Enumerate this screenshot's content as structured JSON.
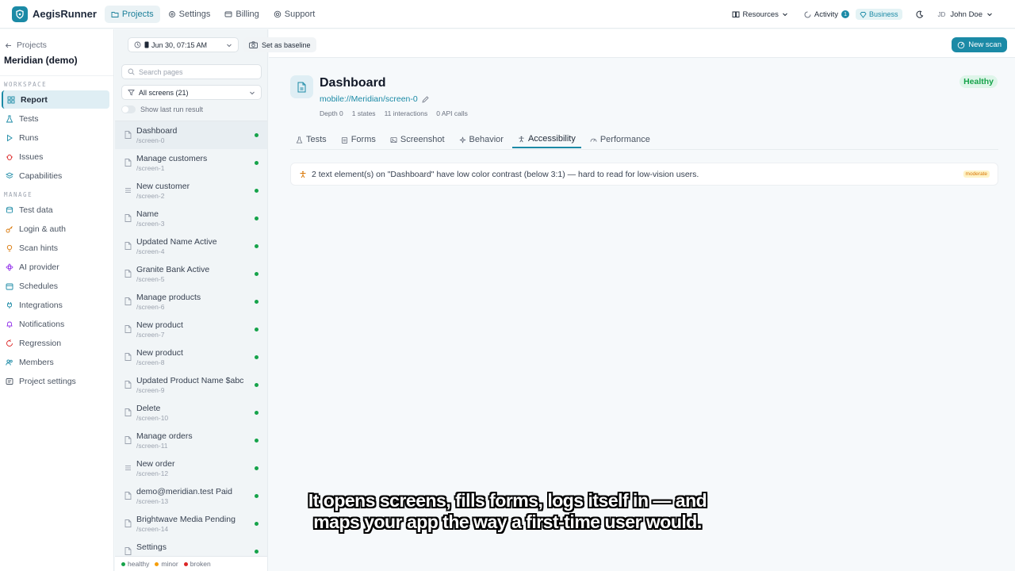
{
  "brand": {
    "name": "AegisRunner"
  },
  "topnav": {
    "items": [
      {
        "label": "Projects",
        "icon": "folder-icon",
        "active": true
      },
      {
        "label": "Settings",
        "icon": "gear-icon",
        "active": false
      },
      {
        "label": "Billing",
        "icon": "card-icon",
        "active": false
      },
      {
        "label": "Support",
        "icon": "support-icon",
        "active": false
      }
    ],
    "resources": "Resources",
    "activity": "Activity",
    "activity_count": "1",
    "plan": "Business",
    "user_initials": "JD",
    "user_name": "John Doe"
  },
  "sidebar": {
    "back_label": "Projects",
    "project_name": "Meridian (demo)",
    "workspace_label": "WORKSPACE",
    "workspace_items": [
      "Report",
      "Tests",
      "Runs",
      "Issues",
      "Capabilities"
    ],
    "manage_label": "MANAGE",
    "manage_items": [
      "Test data",
      "Login & auth",
      "Scan hints",
      "AI provider",
      "Schedules",
      "Integrations",
      "Notifications",
      "Regression",
      "Members",
      "Project settings"
    ]
  },
  "pages_panel": {
    "search_placeholder": "Search pages",
    "filter_value": "All screens (21)",
    "toggle_label": "Show last run result",
    "items": [
      {
        "title": "Dashboard",
        "path": "/screen-0"
      },
      {
        "title": "Manage customers",
        "path": "/screen-1"
      },
      {
        "title": "New customer",
        "path": "/screen-2"
      },
      {
        "title": "Name",
        "path": "/screen-3"
      },
      {
        "title": "Updated Name Active",
        "path": "/screen-4"
      },
      {
        "title": "Granite Bank Active",
        "path": "/screen-5"
      },
      {
        "title": "Manage products",
        "path": "/screen-6"
      },
      {
        "title": "New product",
        "path": "/screen-7"
      },
      {
        "title": "New product",
        "path": "/screen-8"
      },
      {
        "title": "Updated Product Name $abc",
        "path": "/screen-9"
      },
      {
        "title": "Delete",
        "path": "/screen-10"
      },
      {
        "title": "Manage orders",
        "path": "/screen-11"
      },
      {
        "title": "New order",
        "path": "/screen-12"
      },
      {
        "title": "demo@meridian.test Paid",
        "path": "/screen-13"
      },
      {
        "title": "Brightwave Media Pending",
        "path": "/screen-14"
      },
      {
        "title": "Settings",
        "path": ""
      }
    ],
    "legend": {
      "healthy": "healthy",
      "minor": "minor",
      "broken": "broken"
    }
  },
  "toolbar": {
    "run_select": "Jun 30, 07:15 AM",
    "baseline_label": "Set as baseline",
    "new_scan_label": "New scan"
  },
  "page": {
    "title": "Dashboard",
    "url": "mobile://Meridian/screen-0",
    "meta": {
      "depth": "Depth 0",
      "states": "1 states",
      "interactions": "11 interactions",
      "api": "0 API calls"
    },
    "status": "Healthy",
    "tabs": [
      "Tests",
      "Forms",
      "Screenshot",
      "Behavior",
      "Accessibility",
      "Performance"
    ],
    "active_tab": "Accessibility",
    "issue": {
      "text": "2 text element(s) on \"Dashboard\" have low color contrast (below 3:1) — hard to read for low-vision users.",
      "severity": "moderate"
    }
  },
  "caption": {
    "line1": "It opens screens, fills forms, logs itself in — and",
    "line2": "maps your app the way a first-time user would."
  },
  "colors": {
    "accent": "#1b8aa6",
    "healthy": "#16a34a",
    "minor": "#f59e0b",
    "broken": "#dc2626"
  }
}
